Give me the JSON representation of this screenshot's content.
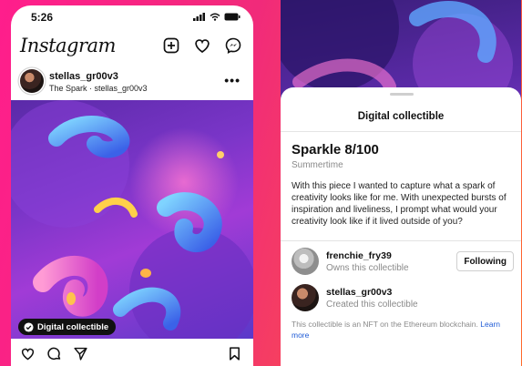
{
  "status_bar": {
    "time": "5:26"
  },
  "app": {
    "logo_text": "Instagram"
  },
  "post": {
    "username": "stellas_gr00v3",
    "subtitle": "The Spark · stellas_gr00v3",
    "more_label": "•••",
    "badge_label": "Digital collectible"
  },
  "sheet": {
    "title": "Digital collectible",
    "nft_name": "Sparkle 8/100",
    "nft_subtitle": "Summertime",
    "description": "With this piece I wanted to capture what a spark of creativity looks like for me. With unexpected bursts of inspiration and liveliness, I prompt what would your creativity look like if it lived outside of you?",
    "owner": {
      "username": "frenchie_fry39",
      "role": "Owns this collectible",
      "button_label": "Following"
    },
    "creator": {
      "username": "stellas_gr00v3",
      "role": "Created this collectible"
    },
    "footer_text": "This collectible is an NFT on the Ethereum blockchain.",
    "footer_link": "Learn more"
  },
  "colors": {
    "background_pink": "#ff1e8c",
    "background_orange": "#ff6a2a",
    "link_blue": "#1f5bd6"
  }
}
